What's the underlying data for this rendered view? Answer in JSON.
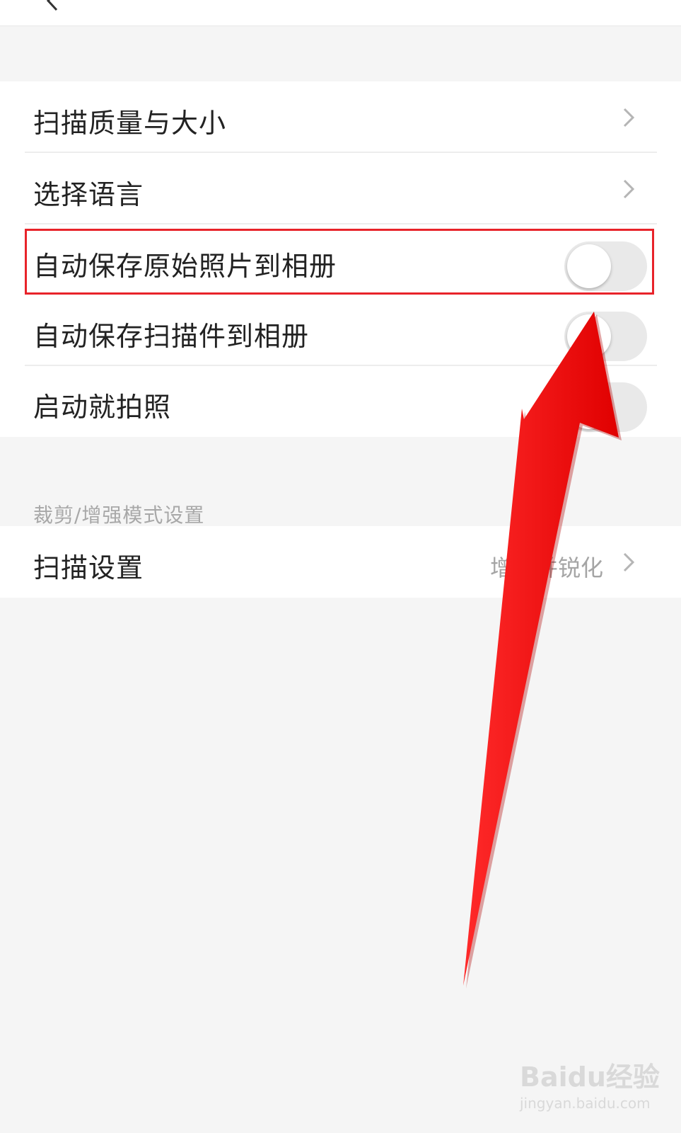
{
  "settings": {
    "items": [
      {
        "label": "扫描质量与大小",
        "type": "link"
      },
      {
        "label": "选择语言",
        "type": "link"
      },
      {
        "label": "自动保存原始照片到相册",
        "type": "toggle",
        "on": false
      },
      {
        "label": "自动保存扫描件到相册",
        "type": "toggle",
        "on": false
      },
      {
        "label": "启动就拍照",
        "type": "toggle",
        "on": false
      }
    ],
    "section_title": "裁剪/增强模式设置",
    "scan_settings": {
      "label": "扫描设置",
      "value": "增强并锐化"
    }
  },
  "icons": {
    "back": "back-arrow-icon",
    "chevron": "chevron-right-icon"
  },
  "colors": {
    "highlight": "#e8232a",
    "arrow": "#ff0000"
  },
  "watermark": {
    "main": "Baidu经验",
    "sub": "jingyan.baidu.com"
  }
}
